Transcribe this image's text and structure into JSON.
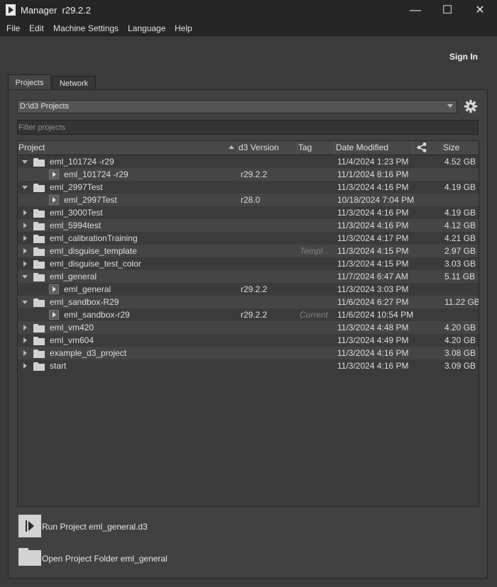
{
  "window": {
    "title": "Manager  r29.2.2",
    "min_glyph": "—",
    "max_glyph": "☐",
    "close_glyph": "✕"
  },
  "menu": {
    "items": [
      "File",
      "Edit",
      "Machine Settings",
      "Language",
      "Help"
    ]
  },
  "account": {
    "sign_in": "Sign In"
  },
  "tabs": [
    {
      "label": "Projects",
      "active": true
    },
    {
      "label": "Network",
      "active": false
    }
  ],
  "projects_folder": {
    "path": "D:\\d3 Projects"
  },
  "filter": {
    "placeholder": "Filter projects"
  },
  "table": {
    "columns": [
      "Project",
      "d3 Version",
      "Tag",
      "Date Modified",
      "",
      "Size"
    ],
    "rows": [
      {
        "kind": "folder",
        "expanded": true,
        "name": "eml_101724 -r29",
        "version": "",
        "tag": "",
        "date": "11/4/2024 1:23 PM",
        "size": "4.52 GB"
      },
      {
        "kind": "file",
        "name": "eml_101724 -r29",
        "version": "r29.2.2",
        "tag": "",
        "date": "11/1/2024 8:16 PM",
        "size": ""
      },
      {
        "kind": "folder",
        "expanded": true,
        "name": "eml_2997Test",
        "version": "",
        "tag": "",
        "date": "11/3/2024 4:16 PM",
        "size": "4.19 GB"
      },
      {
        "kind": "file",
        "name": "eml_2997Test",
        "version": "r28.0",
        "tag": "",
        "date": "10/18/2024 7:04 PM",
        "size": ""
      },
      {
        "kind": "folder",
        "expanded": false,
        "name": "eml_3000Test",
        "version": "",
        "tag": "",
        "date": "11/3/2024 4:16 PM",
        "size": "4.19 GB"
      },
      {
        "kind": "folder",
        "expanded": false,
        "name": "eml_5994test",
        "version": "",
        "tag": "",
        "date": "11/3/2024 4:16 PM",
        "size": "4.12 GB"
      },
      {
        "kind": "folder",
        "expanded": false,
        "name": "eml_calibrationTraining",
        "version": "",
        "tag": "",
        "date": "11/3/2024 4:17 PM",
        "size": "4.21 GB"
      },
      {
        "kind": "folder",
        "expanded": false,
        "name": "eml_disguise_template",
        "version": "",
        "tag": "Templ...",
        "date": "11/3/2024 4:15 PM",
        "size": "2.97 GB"
      },
      {
        "kind": "folder",
        "expanded": false,
        "name": "eml_disguise_test_color",
        "version": "",
        "tag": "",
        "date": "11/3/2024 4:15 PM",
        "size": "3.03 GB"
      },
      {
        "kind": "folder",
        "expanded": true,
        "name": "eml_general",
        "version": "",
        "tag": "",
        "date": "11/7/2024 6:47 AM",
        "size": "5.11 GB"
      },
      {
        "kind": "file",
        "name": "eml_general",
        "version": "r29.2.2",
        "tag": "",
        "date": "11/3/2024 3:03 PM",
        "size": ""
      },
      {
        "kind": "folder",
        "expanded": true,
        "name": "eml_sandbox-R29",
        "version": "",
        "tag": "",
        "date": "11/6/2024 6:27 PM",
        "size": "11.22 GB"
      },
      {
        "kind": "file",
        "name": "eml_sandbox-r29",
        "version": "r29.2.2",
        "tag": "Current",
        "date": "11/6/2024 10:54 PM",
        "size": ""
      },
      {
        "kind": "folder",
        "expanded": false,
        "name": "eml_vm420",
        "version": "",
        "tag": "",
        "date": "11/3/2024 4:48 PM",
        "size": "4.20 GB"
      },
      {
        "kind": "folder",
        "expanded": false,
        "name": "eml_vm604",
        "version": "",
        "tag": "",
        "date": "11/3/2024 4:49 PM",
        "size": "4.20 GB"
      },
      {
        "kind": "folder",
        "expanded": false,
        "name": "example_d3_project",
        "version": "",
        "tag": "",
        "date": "11/3/2024 4:16 PM",
        "size": "3.08 GB"
      },
      {
        "kind": "folder",
        "expanded": false,
        "name": "start",
        "version": "",
        "tag": "",
        "date": "11/3/2024 4:16 PM",
        "size": "3.09 GB"
      }
    ]
  },
  "actions": {
    "run_label": "Run Project eml_general.d3",
    "open_folder_label": "Open Project Folder eml_general"
  }
}
